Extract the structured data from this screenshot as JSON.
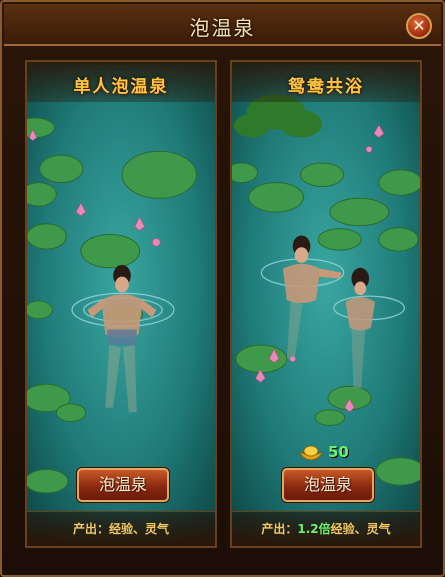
{
  "window": {
    "title": "泡温泉",
    "close_label": "✕"
  },
  "panels": [
    {
      "title": "单人泡温泉",
      "button_label": "泡温泉",
      "output_prefix": "产出：",
      "output_highlight": "",
      "output_suffix": "经验、灵气"
    },
    {
      "title": "鸳鸯共浴",
      "button_label": "泡温泉",
      "cost": "50",
      "cost_icon": "gold-ingot-icon",
      "output_prefix": "产出：",
      "output_highlight": "1.2倍",
      "output_suffix": "经验、灵气"
    }
  ],
  "colors": {
    "accent_gold": "#f8c840",
    "highlight_green": "#6ef06e",
    "button_red": "#a83818"
  }
}
